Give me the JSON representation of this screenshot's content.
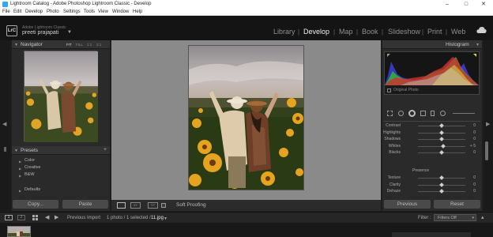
{
  "window": {
    "title": "Lightroom Catalog - Adobe Photoshop Lightroom Classic - Develop",
    "minimize": "–",
    "maximize": "□",
    "close": "✕"
  },
  "menu": [
    "File",
    "Edit",
    "Develop",
    "Photo",
    "Settings",
    "Tools",
    "View",
    "Window",
    "Help"
  ],
  "identity": {
    "logo": "LrC",
    "app_name": "Adobe Lightroom Classic",
    "user": "preeti prajapati",
    "arrow": "▼"
  },
  "modules": [
    "Library",
    "Develop",
    "Map",
    "Book",
    "Slideshow",
    "Print",
    "Web"
  ],
  "active_module": "Develop",
  "navigator": {
    "title": "Navigator",
    "zoom": [
      "FIT",
      "FILL",
      "1:1",
      "3:1"
    ]
  },
  "presets": {
    "title": "Presets",
    "add": "+",
    "items": [
      "Color",
      "Creative",
      "B&W"
    ],
    "defaults": "Defaults"
  },
  "left_buttons": {
    "copy": "Copy...",
    "paste": "Paste"
  },
  "toolbar": {
    "soft_proofing": "Soft Proofing"
  },
  "histogram": {
    "title": "Histogram",
    "original_photo": "Original Photo"
  },
  "basic": [
    {
      "label": "Contrast",
      "value": "0",
      "pos": 0.5
    },
    {
      "label": "Highlights",
      "value": "0",
      "pos": 0.5
    },
    {
      "label": "Shadows",
      "value": "0",
      "pos": 0.5
    },
    {
      "label": "Whites",
      "value": "+ 5",
      "pos": 0.53
    },
    {
      "label": "Blacks",
      "value": "0",
      "pos": 0.5
    }
  ],
  "presence": {
    "title": "Presence",
    "sliders": [
      {
        "label": "Texture",
        "value": "0",
        "pos": 0.5
      },
      {
        "label": "Clarity",
        "value": "0",
        "pos": 0.5
      },
      {
        "label": "Dehaze",
        "value": "0",
        "pos": 0.5
      }
    ]
  },
  "right_buttons": {
    "previous": "Previous",
    "reset": "Reset"
  },
  "filmstrip_bar": {
    "page1": "1",
    "page2": "2",
    "previous_import": "Previous Import",
    "count": "1 photo / 1 selected /",
    "filename": "11.jpg",
    "filter_label": "Filter :",
    "filter_value": "Filters Off"
  },
  "colors": {
    "accent": "#ffffff",
    "panel": "#2a2a2a",
    "background": "#8a8a8a"
  }
}
